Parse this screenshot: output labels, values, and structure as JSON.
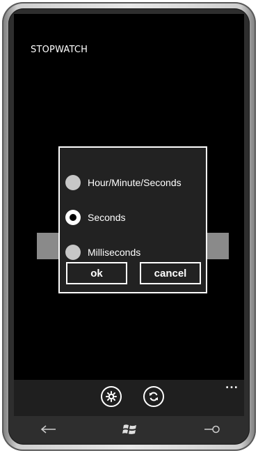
{
  "app": {
    "title": "STOPWATCH"
  },
  "dialog": {
    "options": [
      {
        "label": "Hour/Minute/Seconds",
        "selected": false
      },
      {
        "label": "Seconds",
        "selected": true
      },
      {
        "label": "Milliseconds",
        "selected": false
      }
    ],
    "ok_label": "ok",
    "cancel_label": "cancel"
  },
  "app_bar": {
    "icons": [
      "settings-icon",
      "refresh-icon"
    ],
    "more_label": "..."
  },
  "nav": {
    "icons": [
      "back-icon",
      "windows-logo-icon",
      "search-icon"
    ]
  },
  "colors": {
    "screen_bg": "#000000",
    "dialog_bg": "#222222",
    "accent_white": "#ffffff",
    "app_bar_bg": "#1f1f1f",
    "placeholder_gray": "#8a8a8a"
  }
}
